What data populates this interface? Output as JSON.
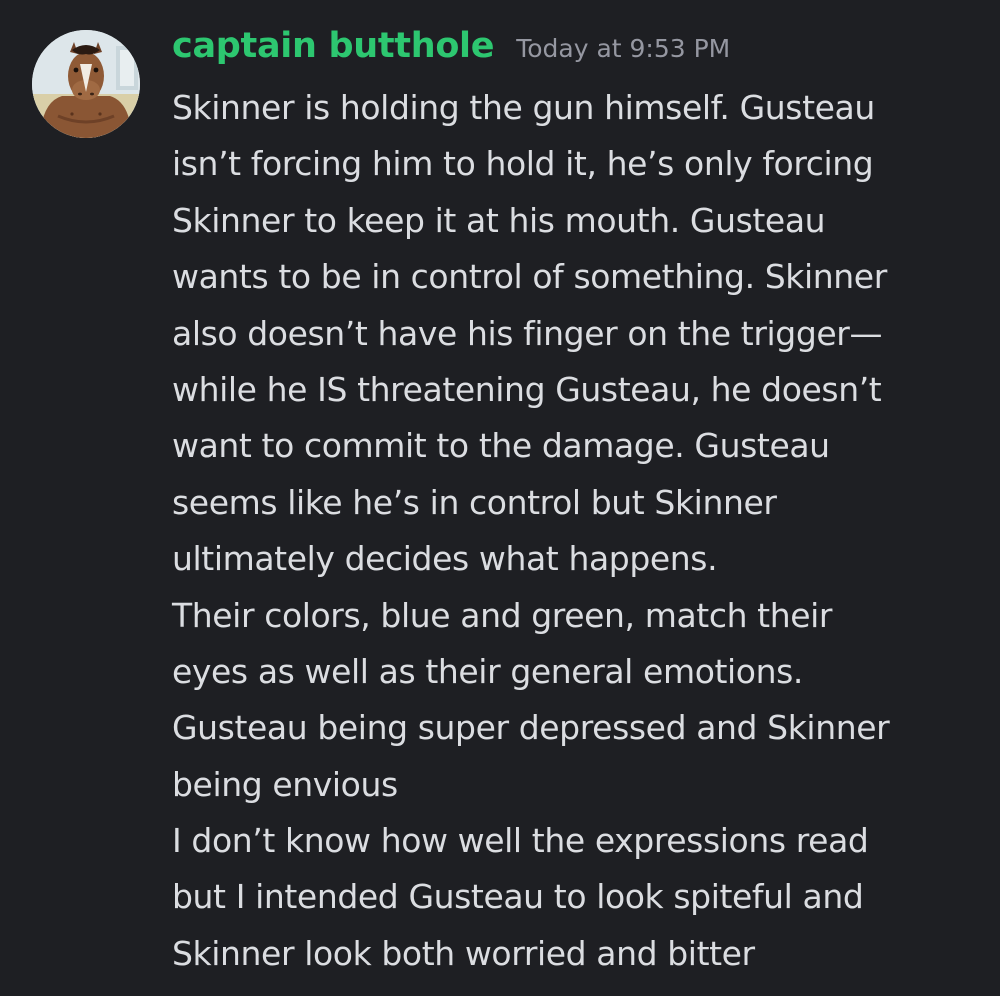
{
  "message": {
    "author": {
      "name": "captain butthole",
      "name_color": "#2dc770",
      "avatar_icon": "horse-character-avatar"
    },
    "timestamp": "Today at 9:53 PM",
    "lines": [
      "Skinner is holding the gun himself. Gusteau",
      "isn’t forcing him to hold it, he’s only forcing",
      "Skinner to keep it at his mouth. Gusteau",
      "wants to be in control of something. Skinner",
      "also doesn’t have his finger on the trigger—",
      "while he IS threatening Gusteau, he doesn’t",
      "want to commit to the damage. Gusteau",
      "seems like he’s in control but Skinner",
      "ultimately decides what happens.",
      "Their colors, blue and green, match their",
      "eyes as well as their general emotions.",
      "Gusteau being super depressed and Skinner",
      "being envious",
      "I don’t know how well the expressions read",
      "but I intended Gusteau to look spiteful and",
      "Skinner look both worried and bitter"
    ]
  },
  "theme": {
    "background": "#1e1f23",
    "text_color": "#dbdde1",
    "timestamp_color": "#9597a1"
  }
}
